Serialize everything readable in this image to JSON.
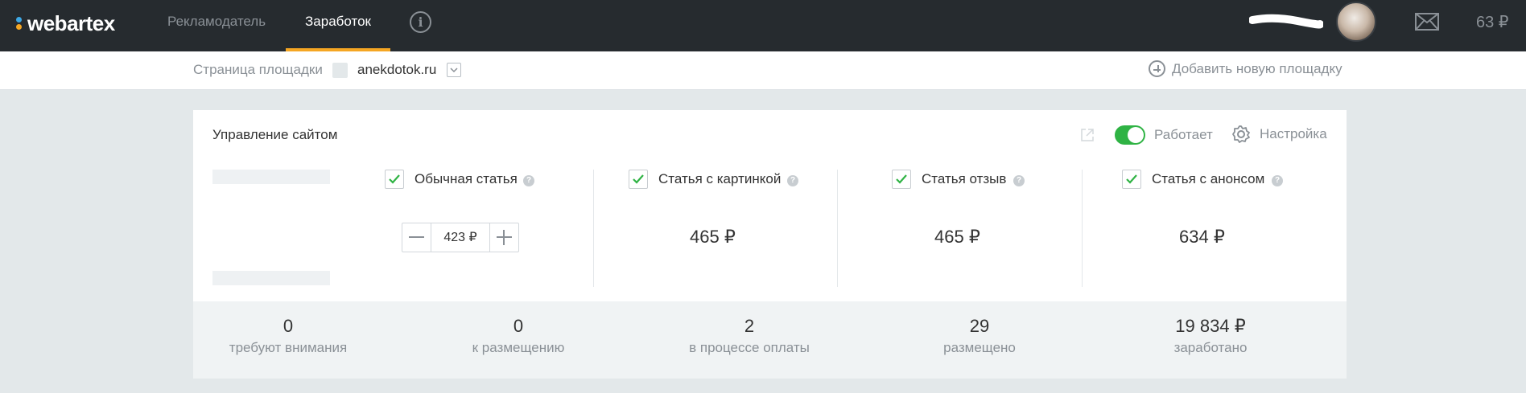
{
  "header": {
    "logo_text": "webartex",
    "tabs": [
      {
        "label": "Рекламодатель",
        "active": false
      },
      {
        "label": "Заработок",
        "active": true
      }
    ],
    "info_icon": "info-circle-icon",
    "balance": "63 ₽",
    "accent_color": "#f5a623"
  },
  "subbar": {
    "site_label": "Страница площадки",
    "site_name": "anekdotok.ru",
    "add_site_label": "Добавить новую площадку"
  },
  "card": {
    "title": "Управление сайтом",
    "status_label": "Работает",
    "status_on": true,
    "settings_label": "Настройка",
    "article_types": [
      {
        "label": "Обычная статья",
        "checked": true,
        "price": "423 ₽"
      },
      {
        "label": "Статья с картинкой",
        "checked": true,
        "price": "465 ₽"
      },
      {
        "label": "Статья отзыв",
        "checked": true,
        "price": "465 ₽"
      },
      {
        "label": "Статья с анонсом",
        "checked": true,
        "price": "634 ₽"
      }
    ],
    "stats": [
      {
        "value": "0",
        "label": "требуют внимания"
      },
      {
        "value": "0",
        "label": "к размещению"
      },
      {
        "value": "2",
        "label": "в процессе оплаты"
      },
      {
        "value": "29",
        "label": "размещено"
      },
      {
        "value": "19 834 ₽",
        "label": "заработано"
      }
    ]
  }
}
